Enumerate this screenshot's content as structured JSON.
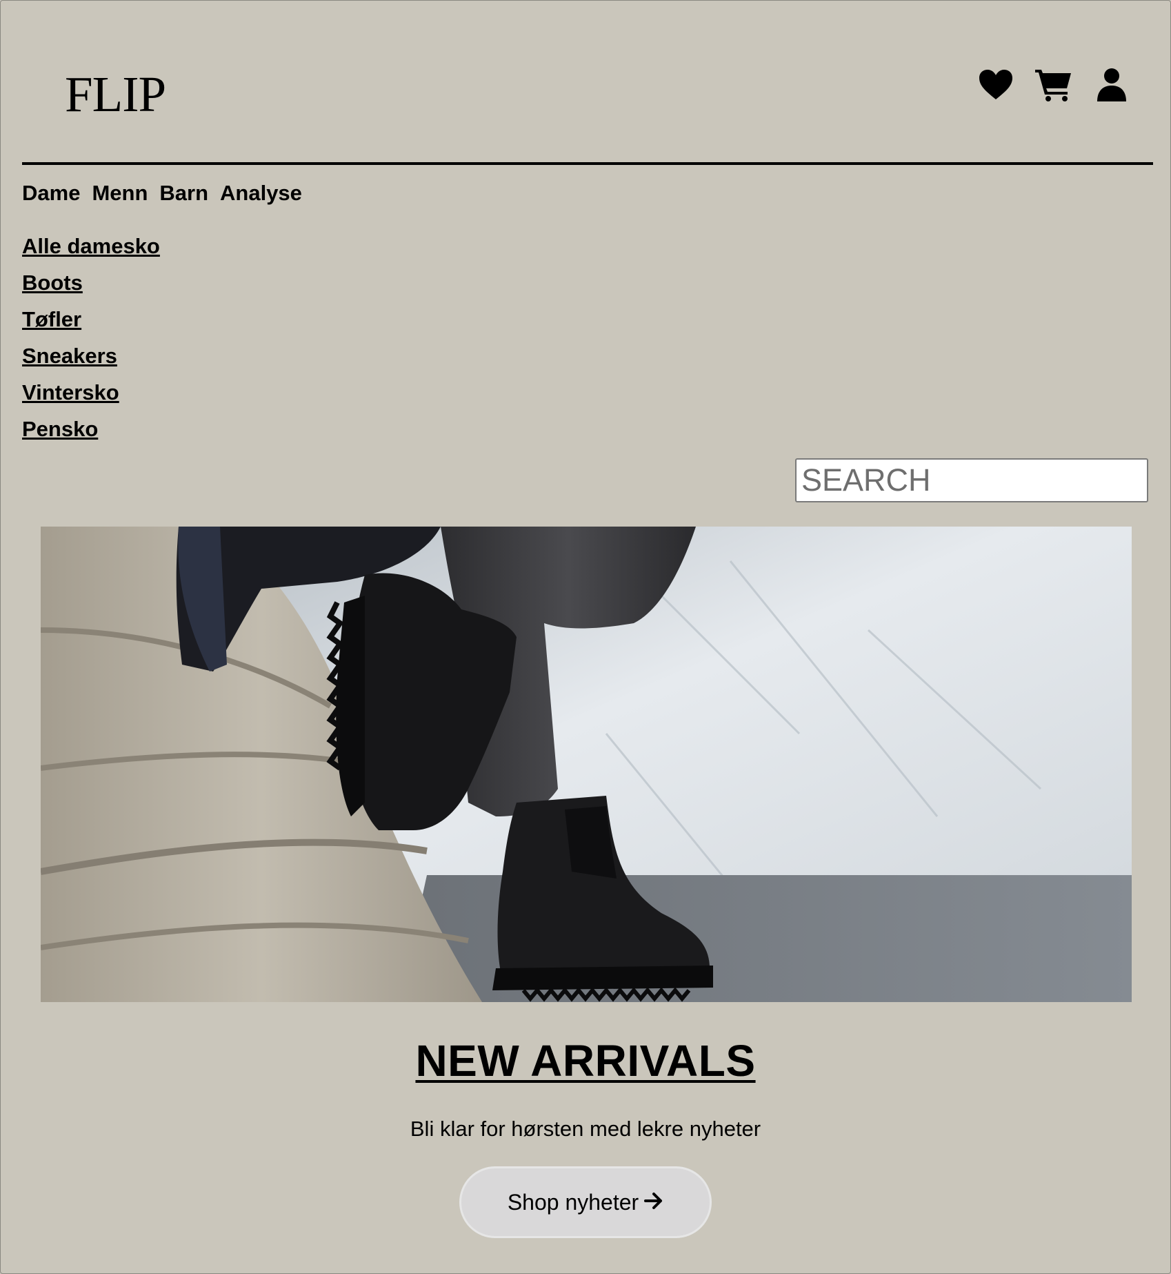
{
  "header": {
    "logo": "FLIP",
    "icons": [
      "heart-icon",
      "cart-icon",
      "user-icon"
    ]
  },
  "nav": {
    "top": [
      "Dame",
      "Menn",
      "Barn",
      "Analyse"
    ],
    "sub": [
      "Alle damesko",
      "Boots",
      "Tøfler",
      "Sneakers",
      "Vintersko",
      "Pensko"
    ]
  },
  "search": {
    "placeholder": "SEARCH",
    "value": ""
  },
  "hero": {
    "image": "black-chelsea-boots-photo",
    "headline": "NEW ARRIVALS",
    "subline": "Bli klar for hørsten med lekre nyheter",
    "cta_label": "Shop nyheter",
    "cta_icon": "arrow-right-icon"
  },
  "colors": {
    "background": "#cac6bb",
    "text": "#000000",
    "button": "#d9d8d9"
  }
}
